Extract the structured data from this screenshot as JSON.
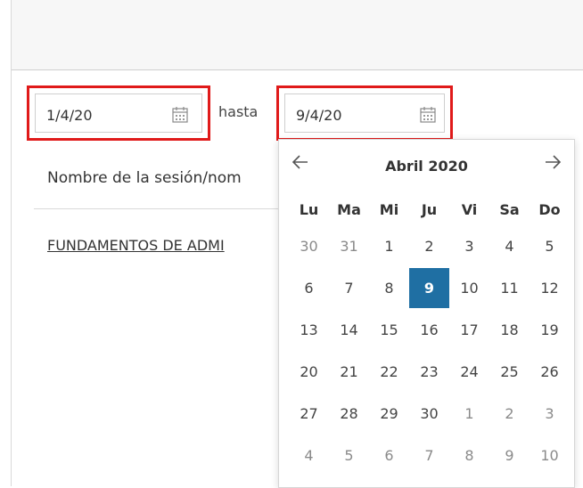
{
  "filters": {
    "start_date": "1/4/20",
    "separator": "hasta",
    "end_date": "9/4/20",
    "highlight_color": "#e01a1a"
  },
  "table": {
    "column_header": "Nombre de la sesión/nom",
    "rows": [
      "FUNDAMENTOS DE ADMI"
    ]
  },
  "calendar": {
    "title": "Abril 2020",
    "prev_icon": "arrow-left-icon",
    "next_icon": "arrow-right-icon",
    "weekdays": [
      "Lu",
      "Ma",
      "Mi",
      "Ju",
      "Vi",
      "Sa",
      "Do"
    ],
    "selected_day": "9",
    "selected_color": "#1f6fa3",
    "weeks": [
      [
        "30",
        "31",
        "1",
        "2",
        "3",
        "4",
        "5"
      ],
      [
        "6",
        "7",
        "8",
        "9",
        "10",
        "11",
        "12"
      ],
      [
        "13",
        "14",
        "15",
        "16",
        "17",
        "18",
        "19"
      ],
      [
        "20",
        "21",
        "22",
        "23",
        "24",
        "25",
        "26"
      ],
      [
        "27",
        "28",
        "29",
        "30",
        "1",
        "2",
        "3"
      ],
      [
        "4",
        "5",
        "6",
        "7",
        "8",
        "9",
        "10"
      ]
    ],
    "other_month": [
      [
        true,
        true,
        false,
        false,
        false,
        false,
        false
      ],
      [
        false,
        false,
        false,
        false,
        false,
        false,
        false
      ],
      [
        false,
        false,
        false,
        false,
        false,
        false,
        false
      ],
      [
        false,
        false,
        false,
        false,
        false,
        false,
        false
      ],
      [
        false,
        false,
        false,
        false,
        true,
        true,
        true
      ],
      [
        true,
        true,
        true,
        true,
        true,
        true,
        true
      ]
    ]
  }
}
